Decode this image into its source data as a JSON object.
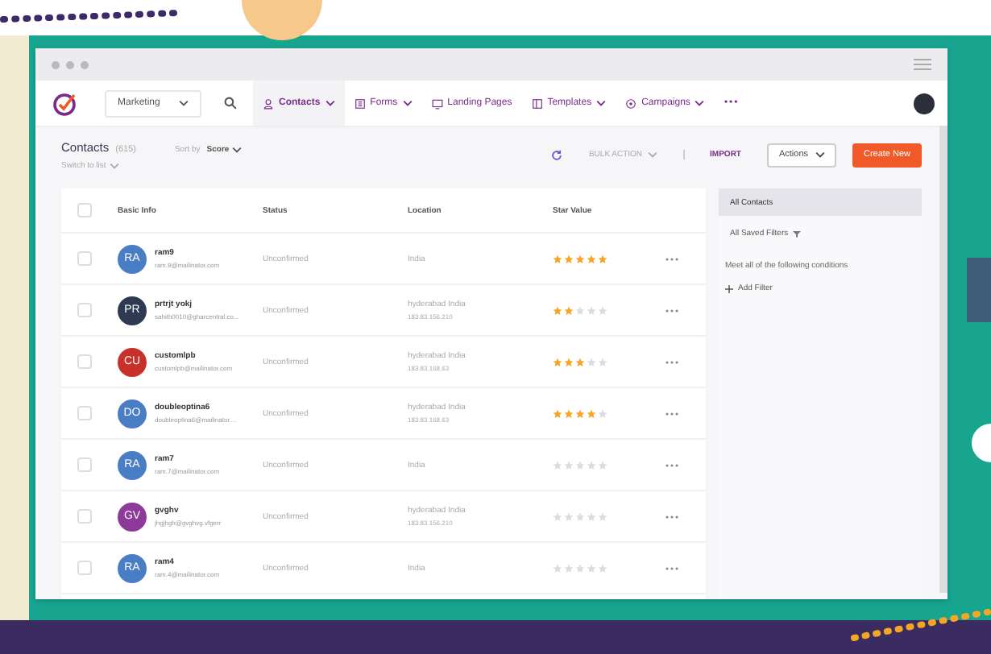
{
  "nav": {
    "workspace": "Marketing",
    "tabs": [
      {
        "label": "Contacts",
        "selected": true,
        "caret": true
      },
      {
        "label": "Forms",
        "selected": false,
        "caret": true
      },
      {
        "label": "Landing Pages",
        "selected": false,
        "caret": false
      },
      {
        "label": "Templates",
        "selected": false,
        "caret": true
      },
      {
        "label": "Campaigns",
        "selected": false,
        "caret": true
      }
    ],
    "more": "•••"
  },
  "toolbar": {
    "title": "Contacts",
    "count": "(615)",
    "sort_label": "Sort by",
    "sort_value": "Score",
    "switch": "Switch to list",
    "bulk_action": "BULK ACTION",
    "import": "IMPORT",
    "actions": "Actions",
    "create": "Create New"
  },
  "table": {
    "select_all": {
      "checked": false
    },
    "columns": [
      "Basic Info",
      "Status",
      "Location",
      "Star Value"
    ],
    "rows": [
      {
        "initials": "RA",
        "color": "#4a7ec4",
        "name": "ram9",
        "email": "ram.9@mailinator.com",
        "status": "Unconfirmed",
        "location": "India",
        "ip": "",
        "stars": 5,
        "checked": false
      },
      {
        "initials": "PR",
        "color": "#2d3a52",
        "name": "prtrjt yokj",
        "email": "sahith0010@gharcentral.co...",
        "status": "Unconfirmed",
        "location": "hyderabad India",
        "ip": "183.83.156.210",
        "stars": 2,
        "checked": false
      },
      {
        "initials": "CU",
        "color": "#c8302a",
        "name": "customlpb",
        "email": "customlpb@mailinator.com",
        "status": "Unconfirmed",
        "location": "hyderabad India",
        "ip": "183.83.168.63",
        "stars": 3,
        "checked": false
      },
      {
        "initials": "DO",
        "color": "#4a7ec4",
        "name": "doubleoptina6",
        "email": "doubleoptina6@mailinator....",
        "status": "Unconfirmed",
        "location": "hyderabad India",
        "ip": "183.83.168.63",
        "stars": 4,
        "checked": false
      },
      {
        "initials": "RA",
        "color": "#4a7ec4",
        "name": "ram7",
        "email": "ram.7@mailinator.com",
        "status": "Unconfirmed",
        "location": "India",
        "ip": "",
        "stars": 0,
        "checked": false
      },
      {
        "initials": "GV",
        "color": "#8e3a9a",
        "name": "gvghv",
        "email": "jhgjhgh@gvghvg.vfgerr",
        "status": "Unconfirmed",
        "location": "hyderabad India",
        "ip": "183.83.156.210",
        "stars": 0,
        "checked": false
      },
      {
        "initials": "RA",
        "color": "#4a7ec4",
        "name": "ram4",
        "email": "ram.4@mailinator.com",
        "status": "Unconfirmed",
        "location": "India",
        "ip": "",
        "stars": 0,
        "checked": false
      }
    ]
  },
  "filters": {
    "items": [
      {
        "label": "All Contacts",
        "selected": true
      }
    ],
    "saved": "All Saved Filters",
    "conditions": "Meet all of the following conditions",
    "add": "Add Filter"
  }
}
